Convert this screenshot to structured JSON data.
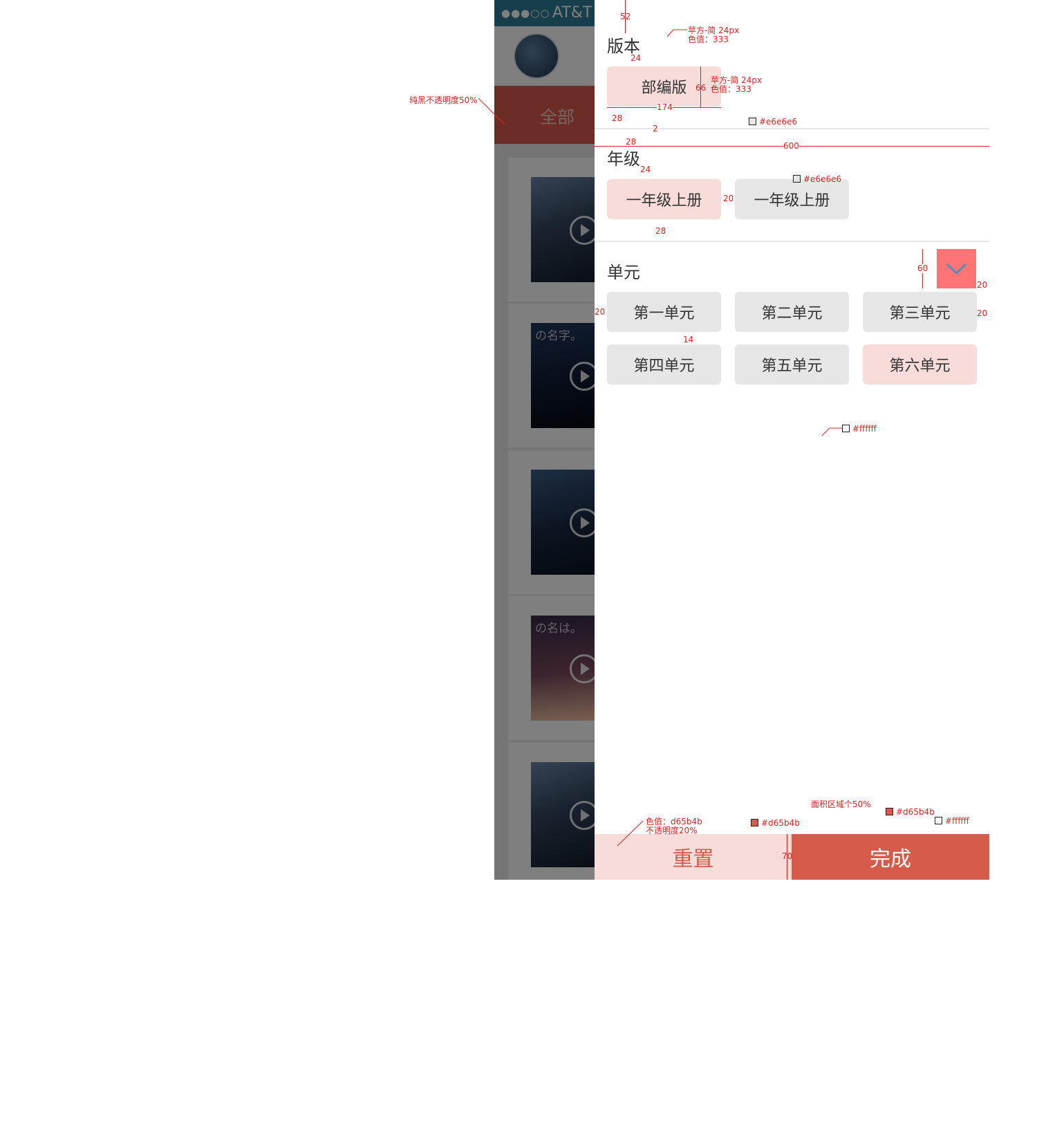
{
  "status_bar": {
    "signal": "●●●○○",
    "carrier": "AT&T"
  },
  "tab_bar": {
    "active_tab": "全部"
  },
  "posters": [
    {
      "text": ""
    },
    {
      "text": "の名字。"
    },
    {
      "text": ""
    },
    {
      "text": "の名は。"
    },
    {
      "text": ""
    }
  ],
  "panel": {
    "version": {
      "title": "版本",
      "options": [
        "部编版"
      ],
      "selected": 0
    },
    "grade": {
      "title": "年级",
      "options": [
        "一年级上册",
        "一年级上册"
      ],
      "selected": 0
    },
    "unit": {
      "title": "单元",
      "options": [
        "第一单元",
        "第二单元",
        "第三单元",
        "第四单元",
        "第五单元",
        "第六单元"
      ],
      "selected": 5
    },
    "reset_label": "重置",
    "done_label": "完成"
  },
  "colors": {
    "accent": "#d65b4b",
    "selected_bg": "#f8dcd9",
    "chip_bg": "#e6e6e6",
    "text": "#333333",
    "toggle": "#ff7474"
  },
  "annotations": {
    "overlay_note": "纯黑不透明度50%",
    "dim_52": "52",
    "font_note_1": "苹方-简 24px",
    "color_note_1": "色值：333",
    "dim_24a": "24",
    "dim_66": "66",
    "font_note_2": "苹方-简 24px",
    "color_note_2": "色值：333",
    "dim_174": "174",
    "dim_28a": "28",
    "dim_2": "2",
    "divider_color": "#e6e6e6",
    "dim_28b": "28",
    "dim_600": "600",
    "dim_24b": "24",
    "chip_color": "#e6e6e6",
    "dim_20a": "20",
    "dim_28c": "28",
    "dim_60": "60",
    "dim_20b": "20",
    "dim_20c": "20",
    "dim_20d": "20",
    "dim_14": "14",
    "bg_color": "#ffffff",
    "area_note": "面积区域个50%",
    "reset_color_note": "色值：d65b4b",
    "reset_opacity_note": "不透明度20%",
    "reset_color": "#d65b4b",
    "dim_70": "70",
    "done_color": "#d65b4b",
    "done_text_color": "#ffffff"
  }
}
